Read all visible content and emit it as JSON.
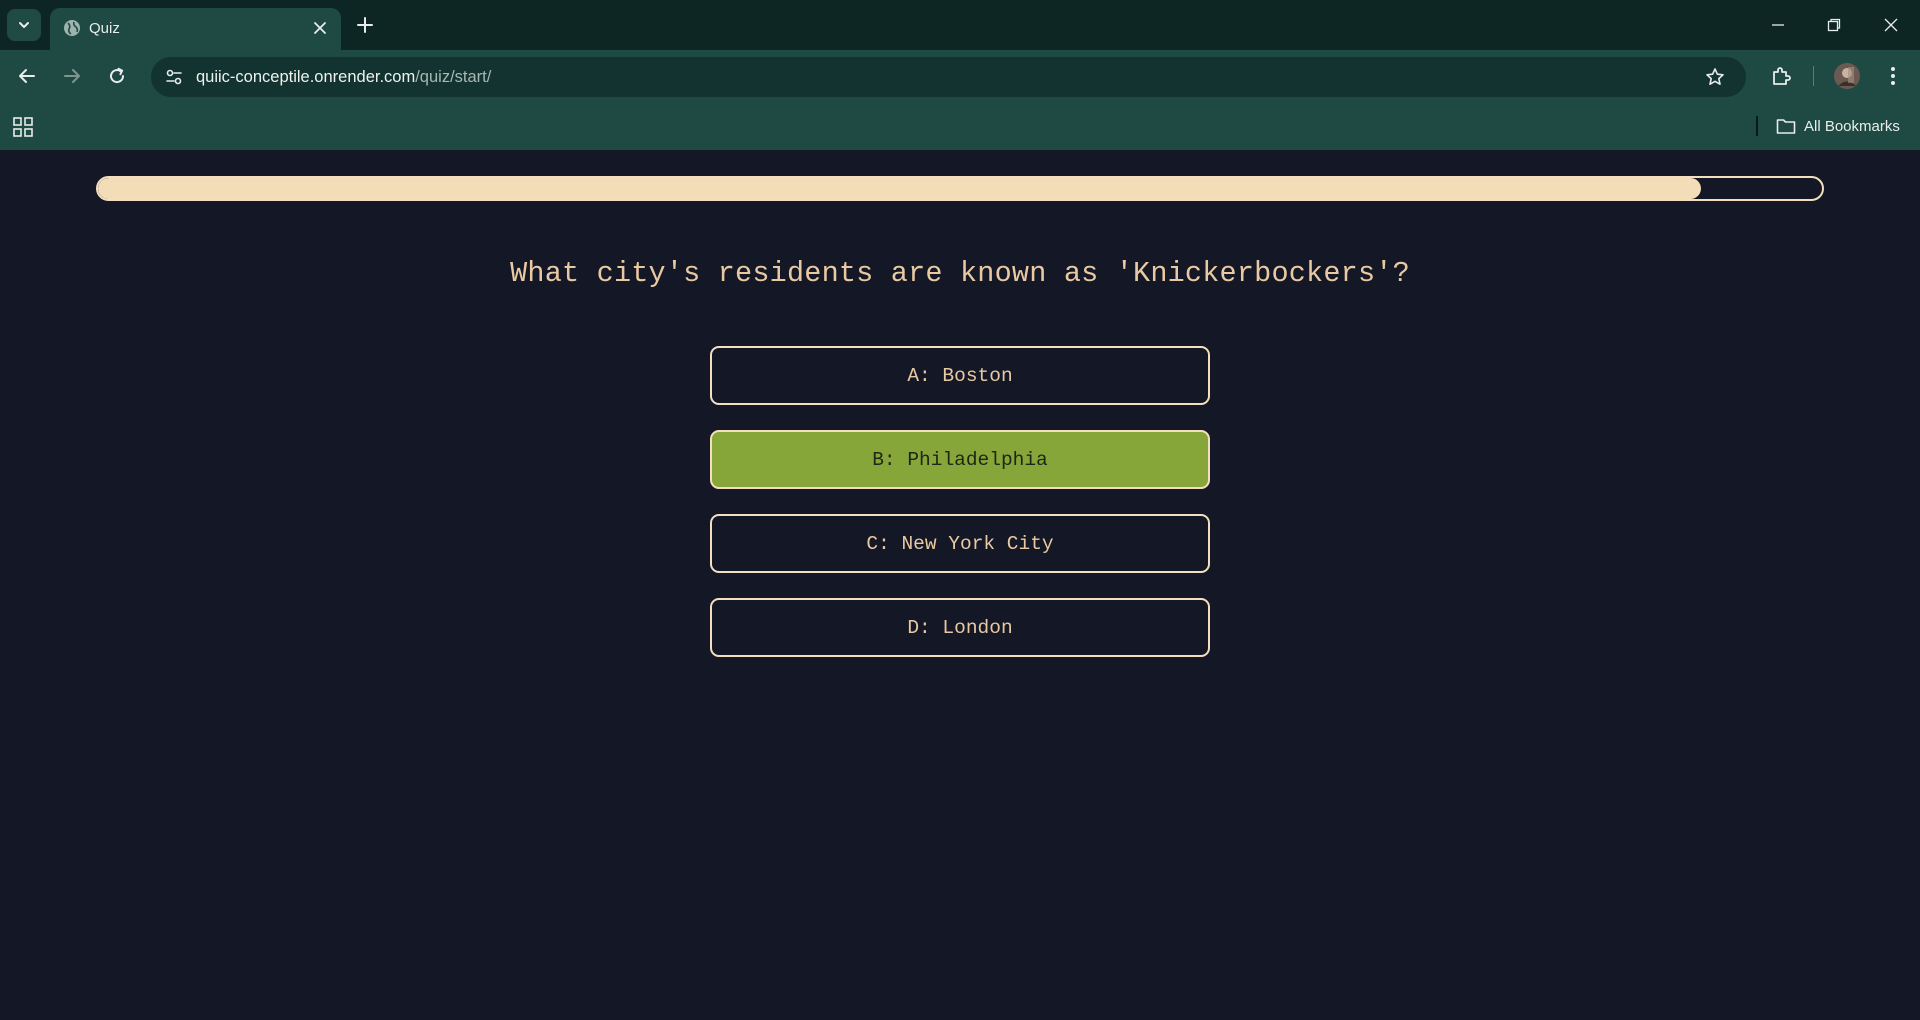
{
  "browser": {
    "tab": {
      "title": "Quiz",
      "favicon": "globe-icon"
    },
    "url": {
      "host": "quiic-conceptile.onrender.com",
      "path": "/quiz/start/"
    },
    "bookmarks": {
      "all_label": "All Bookmarks"
    }
  },
  "quiz": {
    "progress_fraction": 0.93,
    "question": "What city's residents are known as 'Knickerbockers'?",
    "answers": [
      {
        "label": "A: Boston",
        "selected": false
      },
      {
        "label": "B: Philadelphia",
        "selected": true
      },
      {
        "label": "C: New York City",
        "selected": false
      },
      {
        "label": "D: London",
        "selected": false
      }
    ]
  },
  "colors": {
    "page_bg": "#141726",
    "accent_text": "#e9c9a2",
    "border": "#f3dfbf",
    "selected_bg": "#86a63a"
  }
}
